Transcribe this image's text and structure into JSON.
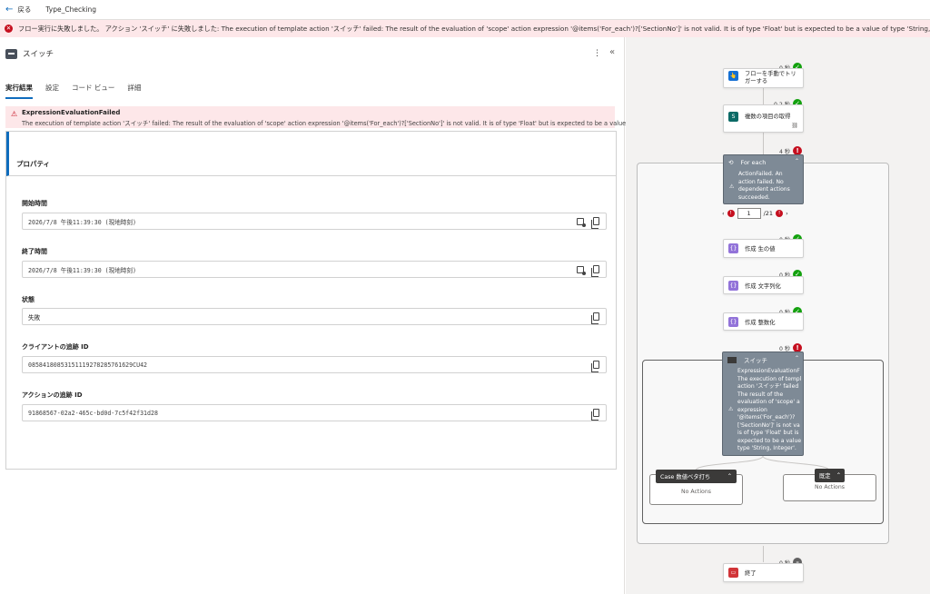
{
  "topbar": {
    "back_label": "戻る",
    "flow_name": "Type_Checking"
  },
  "banner": {
    "message": "フロー実行に失敗しました。 アクション 'スイッチ' に失敗しました: The execution of template action 'スイッチ' failed: The result of the evaluation of 'scope' action expression '@items('For_each')?['SectionNo']' is not valid. It is of type 'Float' but is expected to be a value of type 'String, Integer'."
  },
  "panel": {
    "title": "スイッチ",
    "tabs": [
      "実行結果",
      "設定",
      "コード ビュー",
      "詳細"
    ],
    "error_title": "ExpressionEvaluationFailed",
    "error_detail": "The execution of template action 'スイッチ' failed: The result of the evaluation of 'scope' action expression '@items('For_each')?['SectionNo']' is not valid. It is of type 'Float' but is expected to be a value of type 'String, Integer'.",
    "properties_label": "プロパティ",
    "fields": {
      "start_label": "開始時間",
      "start_value": "2026/7/8 午後11:39:30 (現地時刻)",
      "end_label": "終了時間",
      "end_value": "2026/7/8 午後11:39:30 (現地時刻)",
      "status_label": "状態",
      "status_value": "失敗",
      "client_label": "クライアントの追跡 ID",
      "client_value": "08584180853151119278285761629CU42",
      "action_label": "アクションの追跡 ID",
      "action_value": "91868567-02a2-465c-bd0d-7c5f42f31d28"
    }
  },
  "canvas": {
    "trigger": {
      "label_1": "フローを手動でトリ",
      "label_2": "ガーする",
      "duration": "0 秒"
    },
    "get_items": {
      "label": "複数の項目の取得",
      "duration": "0.2 秒"
    },
    "foreach": {
      "label": "For each",
      "duration": "4 秒",
      "message": [
        "ActionFailed. An",
        "action failed. No",
        "dependent actions",
        "succeeded."
      ],
      "page_value": "1",
      "page_total": "/21"
    },
    "compose1": {
      "label": "作成 生の値",
      "duration": "0 秒"
    },
    "compose2": {
      "label": "作成 文字列化",
      "duration": "0 秒"
    },
    "compose3": {
      "label": "作成 整数化",
      "duration": "0 秒"
    },
    "switch": {
      "label": "スイッチ",
      "duration": "0 秒",
      "message": [
        "ExpressionEvaluationF",
        "The execution of templ",
        "action 'スイッチ' failed",
        "The result of the",
        "evaluation of 'scope' a",
        "expression",
        "'@items('For_each')?",
        "['SectionNo']' is not va",
        "is of type 'Float' but is",
        "expected to be a value",
        "type 'String, Integer'."
      ]
    },
    "case": {
      "label": "Case 数値ベタ打ち",
      "empty": "No Actions"
    },
    "default": {
      "label": "既定",
      "empty": "No Actions"
    },
    "end": {
      "label": "終了",
      "duration": "0 秒"
    }
  }
}
